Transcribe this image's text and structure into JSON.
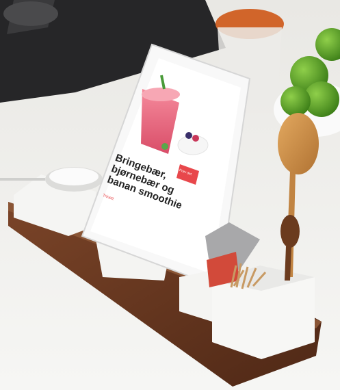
{
  "photo": {
    "recipe_title": "Bringebær, bjørnebær og banan smoothie",
    "button_label": "Prøv det",
    "source_label": "Trinett",
    "colors": {
      "counter": "#f1f1ef",
      "wood": "#6a3b24",
      "ceramic": "#f7f7f5",
      "smoothie": "#e8637c",
      "lime": "#5aa329",
      "accent_red": "#e8474b"
    }
  }
}
